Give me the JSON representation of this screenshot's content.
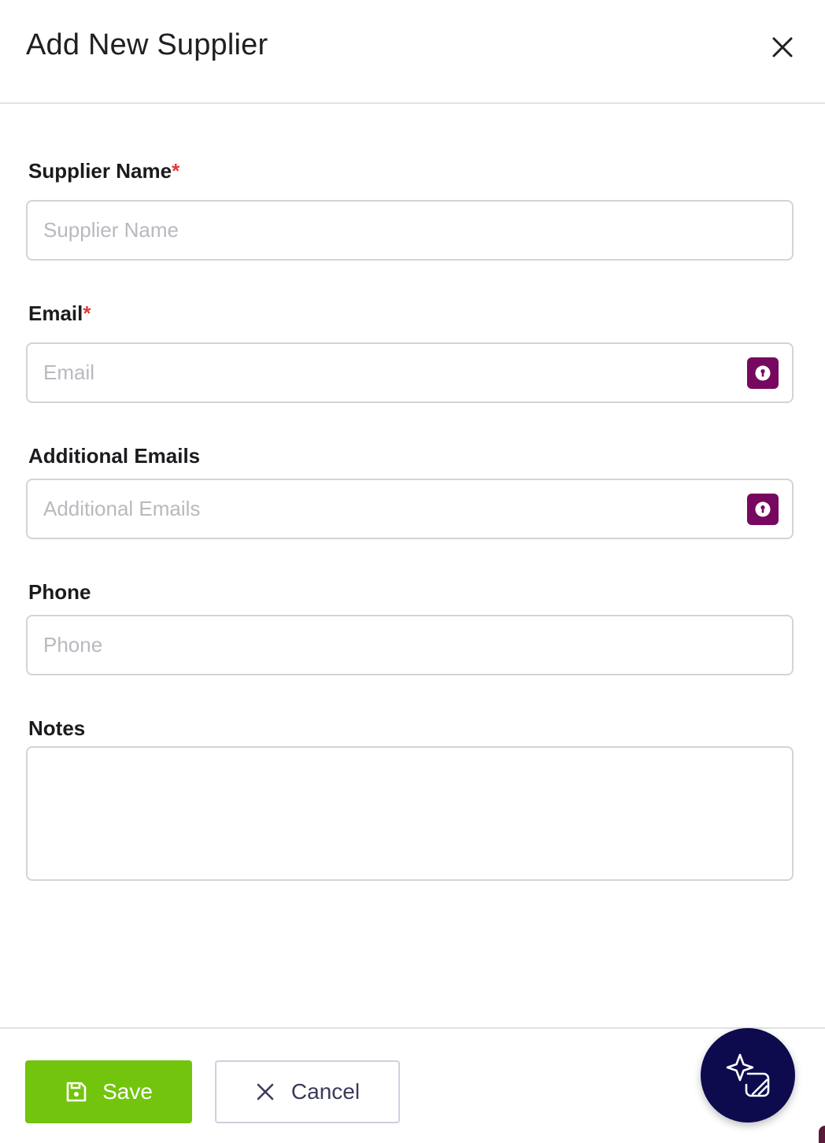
{
  "modal": {
    "title": "Add New Supplier"
  },
  "fields": {
    "supplier_name": {
      "label": "Supplier Name",
      "required_mark": "*",
      "placeholder": "Supplier Name",
      "value": ""
    },
    "email": {
      "label": "Email",
      "required_mark": "*",
      "placeholder": "Email",
      "value": "",
      "icon": "password-key-icon"
    },
    "additional_emails": {
      "label": "Additional Emails",
      "placeholder": "Additional Emails",
      "value": "",
      "icon": "password-key-icon"
    },
    "phone": {
      "label": "Phone",
      "placeholder": "Phone",
      "value": ""
    },
    "notes": {
      "label": "Notes",
      "value": ""
    }
  },
  "footer": {
    "save_label": "Save",
    "save_icon": "floppy-disk-icon",
    "cancel_label": "Cancel",
    "cancel_icon": "close-icon",
    "ai_button_icon": "sparkle-assistant-icon"
  },
  "colors": {
    "accent_key": "#76095f",
    "save_green": "#72c40d",
    "fab_navy": "#0d0b4e",
    "required_red": "#e23a3a"
  }
}
